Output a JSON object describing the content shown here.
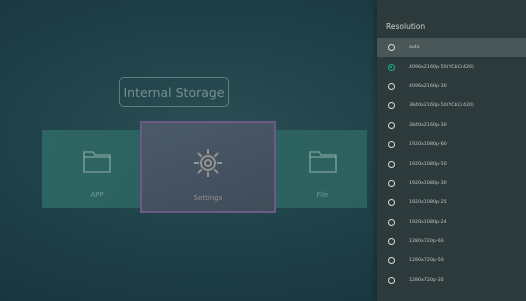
{
  "background": {
    "storage_title": "Internal Storage",
    "tiles": [
      {
        "label": "APP",
        "icon": "folder-icon"
      },
      {
        "label": "Settings",
        "icon": "gear-icon"
      },
      {
        "label": "File",
        "icon": "folder-icon"
      }
    ]
  },
  "panel": {
    "title": "Resolution",
    "options": [
      {
        "label": "auto",
        "checked": false,
        "focused": true
      },
      {
        "label": "4096x2160p-50(YCbCr420)",
        "checked": true,
        "focused": false
      },
      {
        "label": "4096x2160p-30",
        "checked": false,
        "focused": false
      },
      {
        "label": "3840x2160p-50(YCbCr420)",
        "checked": false,
        "focused": false
      },
      {
        "label": "3840x2160p-30",
        "checked": false,
        "focused": false
      },
      {
        "label": "1920x1080p-60",
        "checked": false,
        "focused": false
      },
      {
        "label": "1920x1080p-50",
        "checked": false,
        "focused": false
      },
      {
        "label": "1920x1080p-30",
        "checked": false,
        "focused": false
      },
      {
        "label": "1920x1080p-25",
        "checked": false,
        "focused": false
      },
      {
        "label": "1920x1080p-24",
        "checked": false,
        "focused": false
      },
      {
        "label": "1280x720p-60",
        "checked": false,
        "focused": false
      },
      {
        "label": "1280x720p-50",
        "checked": false,
        "focused": false
      },
      {
        "label": "1280x720p-30",
        "checked": false,
        "focused": false
      }
    ]
  },
  "colors": {
    "accent": "#1fae8c",
    "panel_bg": "#2c3a3c",
    "focus_bg": "#4a5758"
  }
}
